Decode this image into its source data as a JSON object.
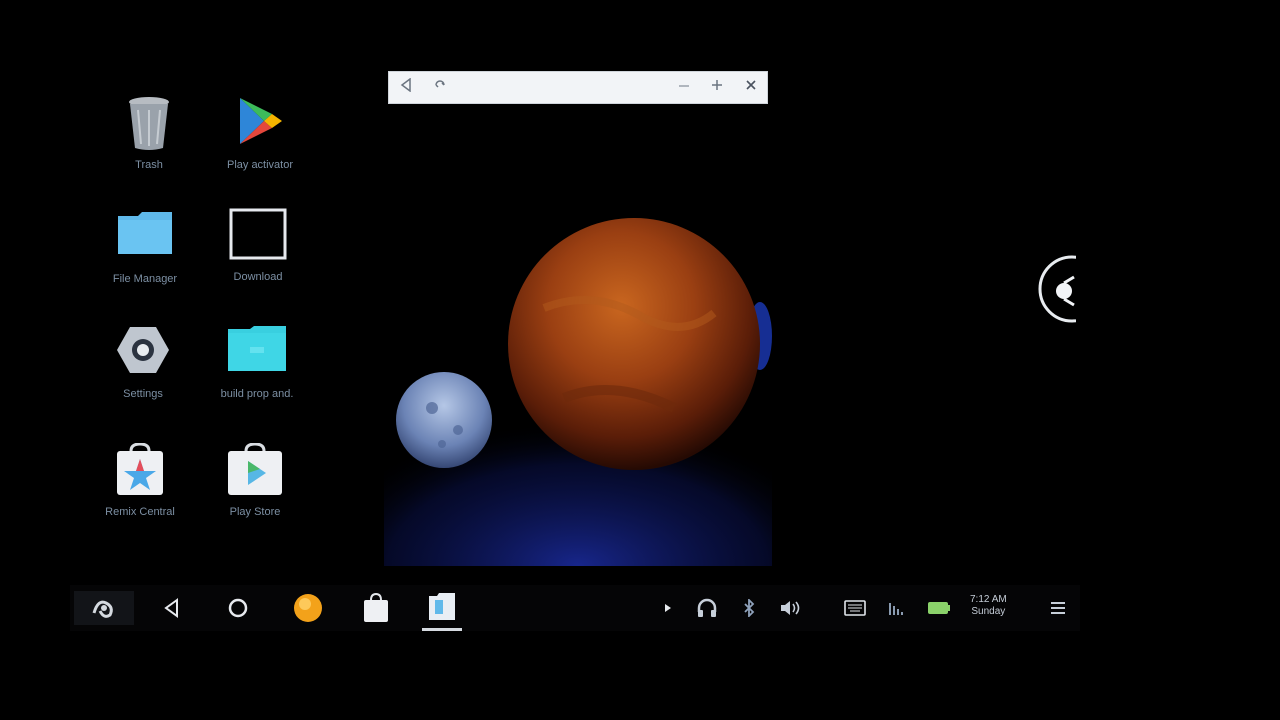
{
  "desktop": {
    "icons": [
      {
        "label": "Trash",
        "icon": "trash-icon"
      },
      {
        "label": "Play activator",
        "icon": "play-logo-icon"
      },
      {
        "label": "File Manager",
        "icon": "folder-icon"
      },
      {
        "label": "Download",
        "icon": "download-folder-icon"
      },
      {
        "label": "Settings",
        "icon": "gear-icon"
      },
      {
        "label": "build prop and.",
        "icon": "app-icon"
      },
      {
        "label": "Remix Central",
        "icon": "remix-central-icon"
      },
      {
        "label": "Play Store",
        "icon": "play-store-icon"
      }
    ]
  },
  "window": {
    "controls": [
      "back-icon",
      "rotate-icon",
      "minimize-icon",
      "maximize-icon",
      "close-icon"
    ],
    "content": "planet-wallpaper"
  },
  "taskbar": {
    "start": "start-menu-icon",
    "nav": [
      "back-icon",
      "home-icon"
    ],
    "apps": [
      "orange-app-icon",
      "shopping-bag-icon",
      "active-app-icon"
    ],
    "tray": [
      "arrow-icon",
      "headphones-icon",
      "bluetooth-icon",
      "volume-icon",
      "keyboard-icon",
      "wifi-icon",
      "battery-icon"
    ],
    "clock": {
      "time": "7:12 AM",
      "day": "Sunday"
    },
    "menu": "notifications-icon"
  },
  "colors": {
    "background": "#000000",
    "taskbar": "#050506",
    "window_bar": "#f2f4f7",
    "folder": "#5fb9ea",
    "teal_folder": "#3fd0e2"
  }
}
